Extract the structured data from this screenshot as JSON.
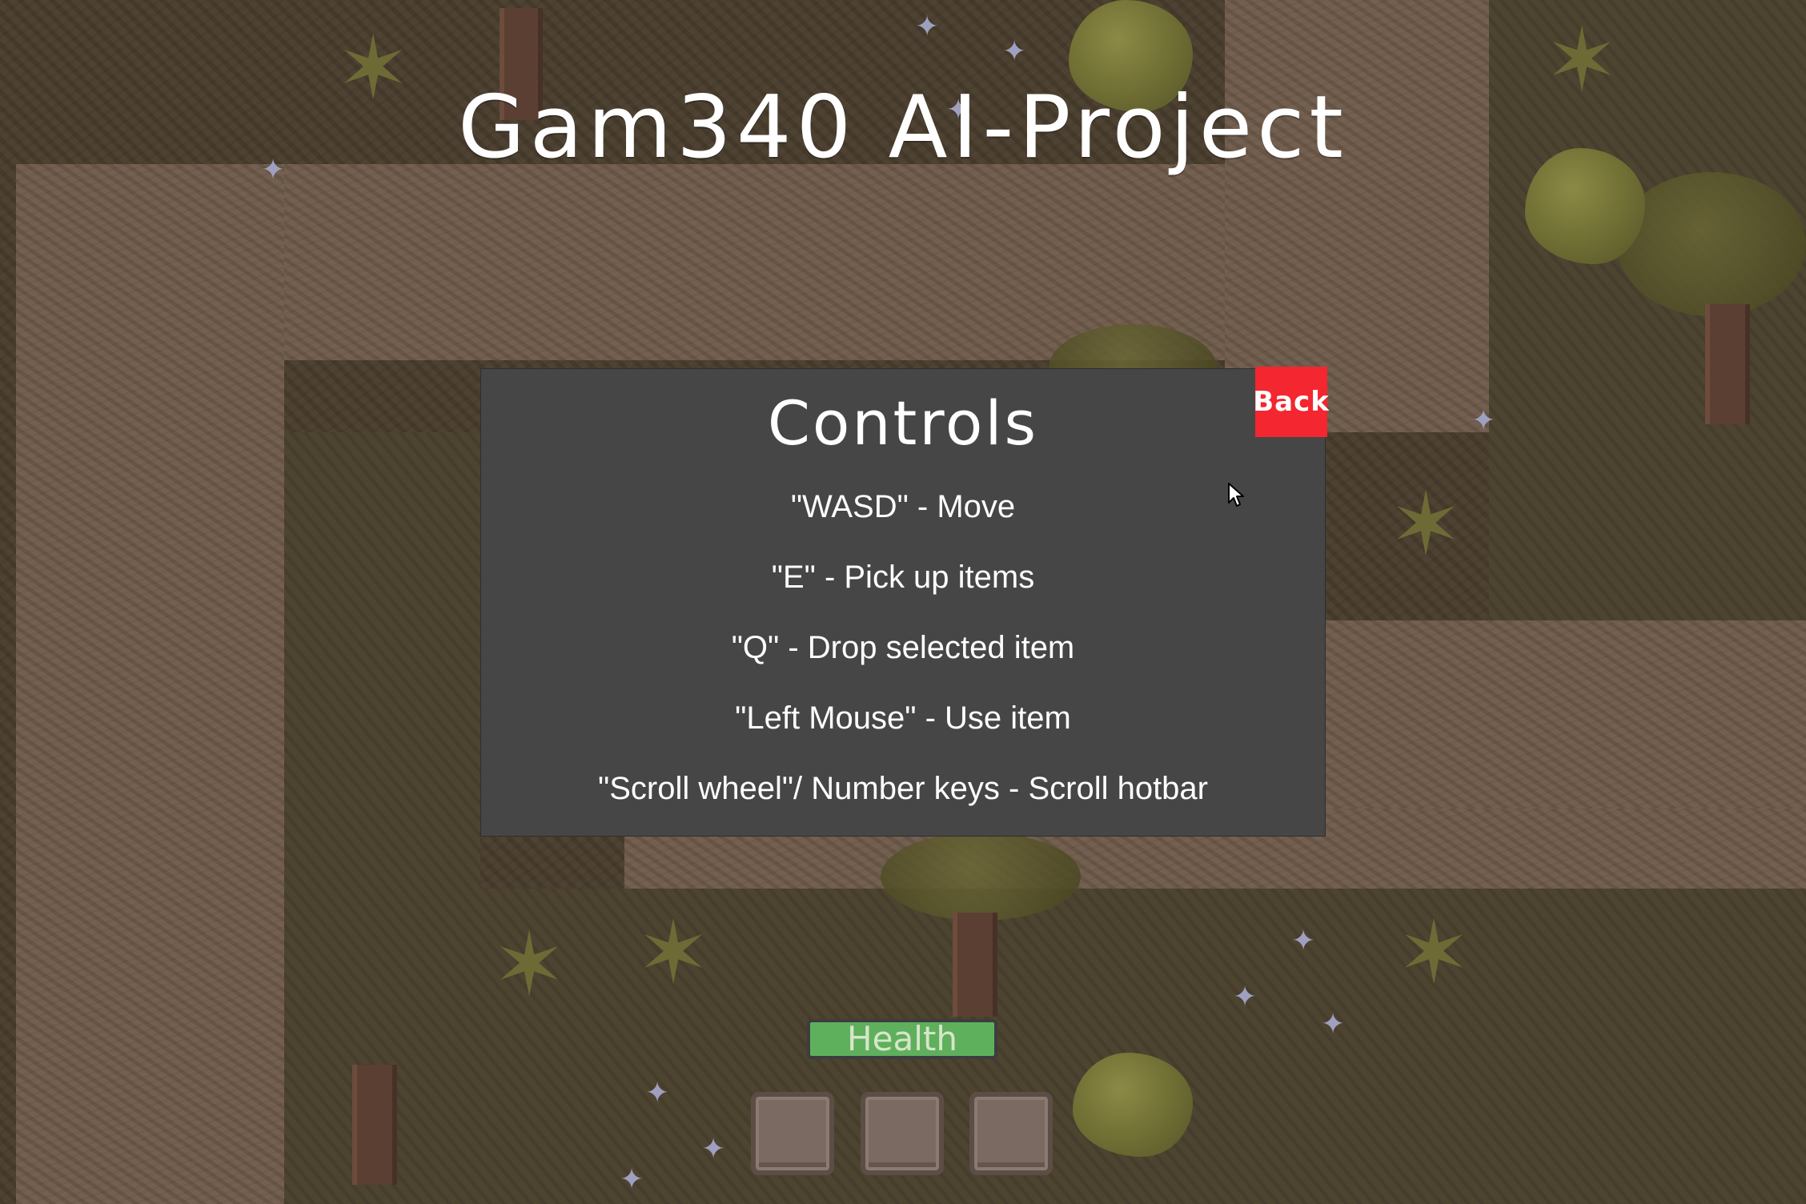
{
  "game": {
    "title": "Gam340 AI-Project"
  },
  "controls_menu": {
    "heading": "Controls",
    "back_label": "Back",
    "lines": [
      "\"WASD\" - Move",
      "\"E\" - Pick up items",
      "\"Q\" - Drop selected item",
      "\"Left Mouse\" - Use item",
      "\"Scroll wheel\"/ Number keys - Scroll hotbar"
    ]
  },
  "hud": {
    "health_label": "Health",
    "health_fraction": 1.0,
    "hotbar_slot_count": 3
  },
  "colors": {
    "panel": "#464646",
    "back_button": "#f4262f",
    "health_fill": "#5fb05d",
    "ground_path": "#6f5b4b",
    "ground_dark": "#4a3e2e"
  }
}
